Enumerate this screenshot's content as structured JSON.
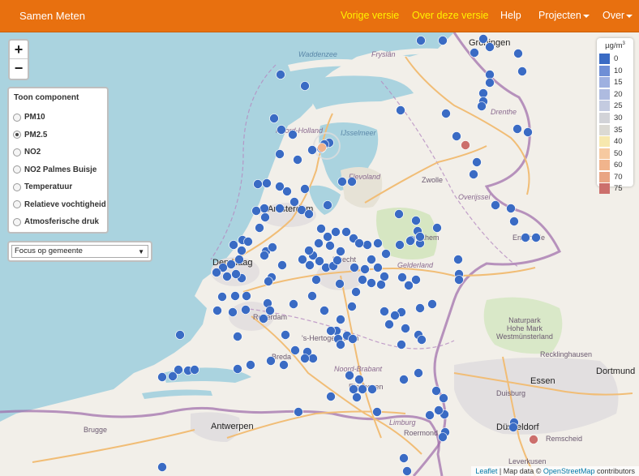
{
  "navbar": {
    "brand": "Samen Meten",
    "vorige": "Vorige versie",
    "over_versie": "Over deze versie",
    "help": "Help",
    "projecten": "Projecten",
    "over": "Over"
  },
  "zoom": {
    "in": "+",
    "out": "−"
  },
  "panel": {
    "title": "Toon component",
    "options": [
      "PM10",
      "PM2.5",
      "NO2",
      "NO2 Palmes Buisje",
      "Temperatuur",
      "Relatieve vochtigheid",
      "Atmosferische druk"
    ],
    "selected": "PM2.5"
  },
  "gemeente_select": {
    "label": "Focus op gemeente"
  },
  "legend": {
    "unit": "µg/m",
    "unit_sup": "3",
    "items": [
      {
        "label": "0",
        "color": "#3a6bc4"
      },
      {
        "label": "10",
        "color": "#6f8fd6"
      },
      {
        "label": "15",
        "color": "#9eb0e0"
      },
      {
        "label": "20",
        "color": "#aebbe0"
      },
      {
        "label": "25",
        "color": "#c4cbe0"
      },
      {
        "label": "30",
        "color": "#d2d3d8"
      },
      {
        "label": "35",
        "color": "#dbd9d3"
      },
      {
        "label": "40",
        "color": "#f7e8ae"
      },
      {
        "label": "50",
        "color": "#f6c9a0"
      },
      {
        "label": "60",
        "color": "#f1b48c"
      },
      {
        "label": "70",
        "color": "#e9a584"
      },
      {
        "label": "75",
        "color": "#cc6f6c"
      }
    ]
  },
  "attribution": {
    "leaflet": "Leaflet",
    "sep": " | Map data © ",
    "osm": "OpenStreetMap",
    "contrib": " contributors"
  },
  "map_labels": {
    "waddenzee": "Waddenzee",
    "fryslan": "Fryslân",
    "groningen": "Groningen",
    "drenthe": "Drenthe",
    "noord_holland": "Noord-Holland",
    "ijsselmeer": "IJsselmeer",
    "flevoland": "Flevoland",
    "zwolle": "Zwolle",
    "overijssel": "Overijssel",
    "amsterdam": "Amsterdam",
    "gelderland": "Gelderland",
    "arnhem": "Arnhem",
    "den_haag": "Den Haag",
    "rotterdam": "Rotterdam",
    "utrecht": "Utrecht",
    "den_bosch": "'s-Hertogenbosch",
    "breda": "Breda",
    "noord_brabant": "Noord-Brabant",
    "eindhoven": "Eindhoven",
    "limburg": "Limburg",
    "antwerpen": "Antwerpen",
    "brugge": "Brugge",
    "dortmund": "Dortmund",
    "essen": "Essen",
    "duisburg": "Duisburg",
    "dusseldorf": "Düsseldorf",
    "remscheid": "Remscheid",
    "leverkusen": "Leverkusen",
    "recklinghausen": "Recklinghausen",
    "naturpark": "Naturpark\nHohe Mark\nWestmünsterland",
    "roermond": "Roermond",
    "enschede": "Enschede"
  },
  "station_colors": {
    "blue": "#3a6bc4",
    "red": "#cc6f6c",
    "peach": "#f1b48c"
  }
}
